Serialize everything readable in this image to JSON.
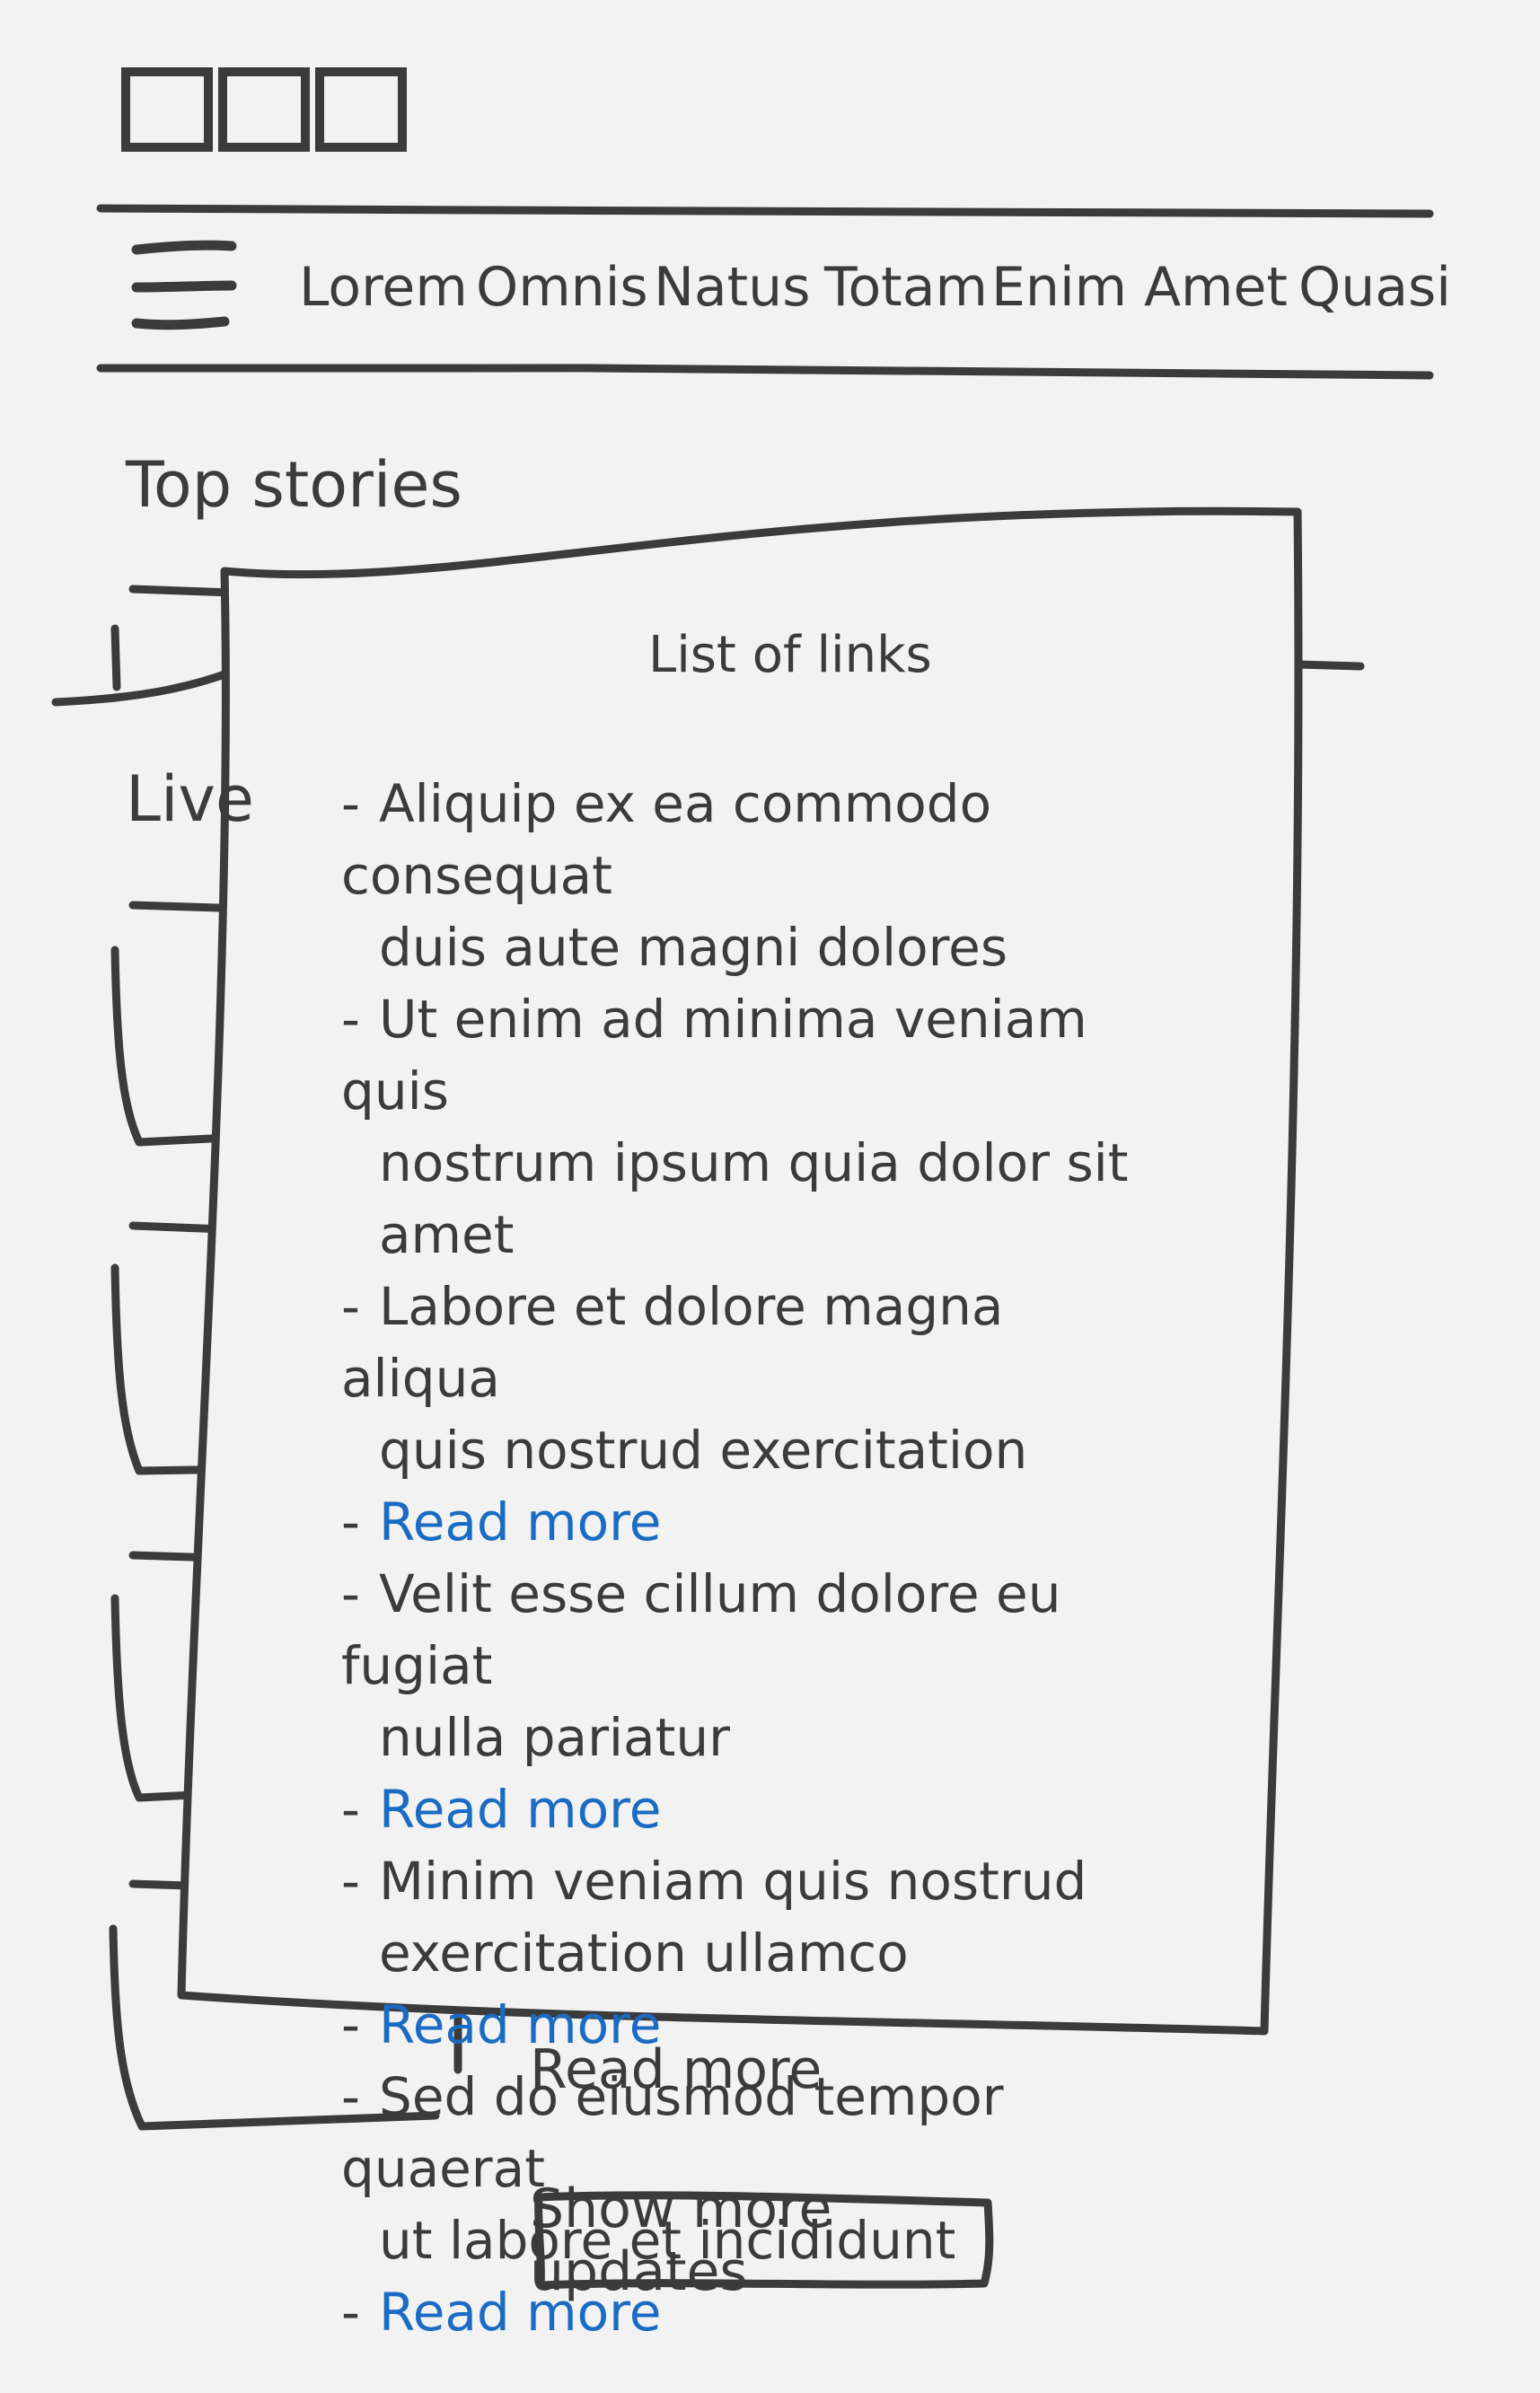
{
  "nav": {
    "items": [
      "Lorem",
      "Omnis",
      "Natus",
      "Totam",
      "Enim",
      "Amet",
      "Quasi"
    ]
  },
  "sections": {
    "top_stories": "Top stories",
    "live": "Live"
  },
  "popup": {
    "title": "List of links",
    "items": [
      {
        "type": "text",
        "lines": [
          "Aliquip ex ea commodo consequat",
          "duis aute magni dolores"
        ]
      },
      {
        "type": "text",
        "lines": [
          "Ut enim ad minima veniam quis",
          "nostrum ipsum quia dolor sit amet"
        ]
      },
      {
        "type": "text",
        "lines": [
          "Labore et dolore magna aliqua",
          "quis nostrud exercitation"
        ]
      },
      {
        "type": "link",
        "lines": [
          "Read more"
        ]
      },
      {
        "type": "text",
        "lines": [
          "Velit esse cillum dolore eu fugiat",
          "nulla pariatur"
        ]
      },
      {
        "type": "link",
        "lines": [
          "Read more"
        ]
      },
      {
        "type": "text",
        "lines": [
          "Minim veniam quis nostrud",
          "exercitation ullamco"
        ]
      },
      {
        "type": "link",
        "lines": [
          "Read more"
        ]
      },
      {
        "type": "text",
        "lines": [
          "Sed do eiusmod tempor quaerat",
          "ut labore et incididunt"
        ]
      },
      {
        "type": "link",
        "lines": [
          "Read more"
        ]
      }
    ]
  },
  "background": {
    "read_more": "Read more"
  },
  "actions": {
    "show_more": "Show more updates"
  },
  "colors": {
    "ink": "#3b3b3b",
    "link": "#1a6bc4",
    "background": "#f2f2f2"
  }
}
